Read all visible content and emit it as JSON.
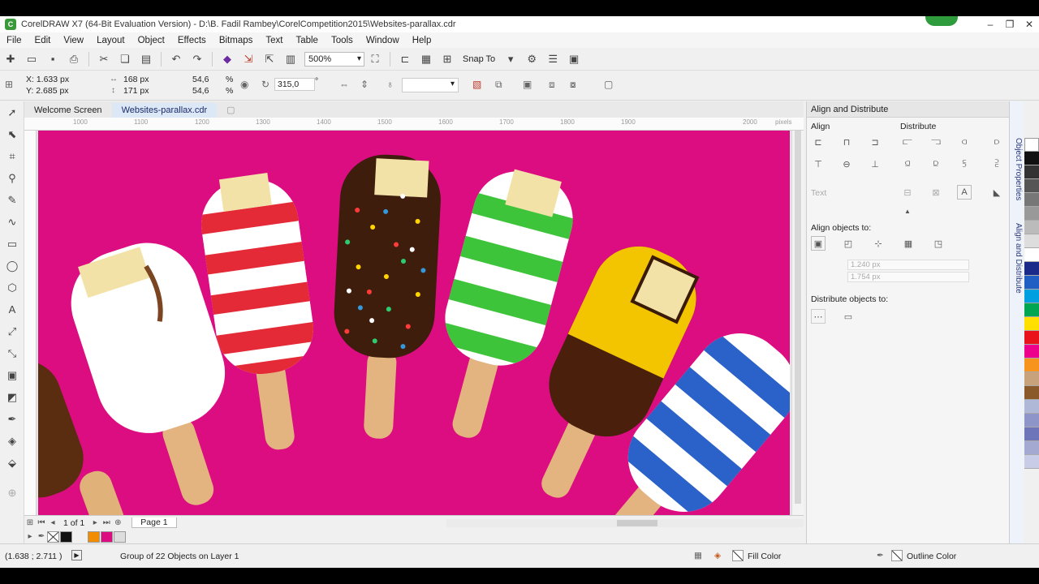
{
  "window": {
    "title": "CorelDRAW X7 (64-Bit Evaluation Version) - D:\\B. Fadil Rambey\\CorelCompetition2015\\Websites-parallax.cdr"
  },
  "menu": [
    "File",
    "Edit",
    "View",
    "Layout",
    "Object",
    "Effects",
    "Bitmaps",
    "Text",
    "Table",
    "Tools",
    "Window",
    "Help"
  ],
  "toolbar": {
    "zoom": "500%",
    "snap_to": "Snap To"
  },
  "property_bar": {
    "x": "X: 1.633 px",
    "y": "Y: 2.685 px",
    "width": "168 px",
    "height": "171 px",
    "scale_w": "54,6",
    "scale_h": "54,6",
    "pct": "%",
    "rotation": "315,0",
    "deg": "°"
  },
  "doc_tabs": [
    "Welcome Screen",
    "Websites-parallax.cdr"
  ],
  "ruler_labels": [
    "1000",
    "1100",
    "1200",
    "1300",
    "1400",
    "1500",
    "1600",
    "1700",
    "1800",
    "1900",
    "2000"
  ],
  "ruler_unit": "pixels",
  "page_nav": {
    "count": "1 of 1",
    "page_tab": "Page 1"
  },
  "status": {
    "coords": "(1.638 ; 2.711 )",
    "info": "Group of 22 Objects on Layer 1",
    "fill": "Fill Color",
    "outline": "Outline Color"
  },
  "panel": {
    "title": "Align and Distribute",
    "align": "Align",
    "distribute": "Distribute",
    "text": "Text",
    "align_to": "Align objects to:",
    "x_val": "1.240 px",
    "y_val": "1.754 px",
    "distribute_to": "Distribute objects to:"
  },
  "side_tabs": [
    "Object Properties",
    "Align and Distribute"
  ],
  "colors": {
    "artboard": "#dc0d81",
    "palette": [
      "#111111",
      "#333333",
      "#555555",
      "#777777",
      "#999999",
      "#bbbbbb",
      "#dddddd",
      "#ffffff",
      "#1a2a8a",
      "#1f5fc4",
      "#00a0e0",
      "#00a651",
      "#ffe000",
      "#e8131b",
      "#ec008c",
      "#f7941d",
      "#c8a27a",
      "#8b5a2b",
      "#b0b8d8",
      "#8e95c8",
      "#6e75b8",
      "#a4a9d2",
      "#c9cce6"
    ]
  }
}
